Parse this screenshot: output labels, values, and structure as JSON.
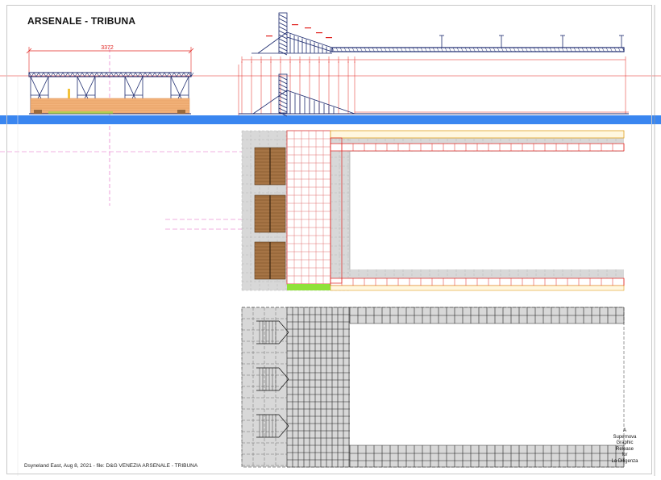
{
  "sheet": {
    "title": "ARSENALE - TRIBUNA",
    "footer": "Dsyneland East,  Aug 8, 2021 -  file:  D&G VENEZIA ARSENALE - TRIBUNA",
    "credit_lines": [
      "A",
      "Supernova",
      "Graphic",
      "Release",
      "for",
      "La Diligenza"
    ]
  },
  "drawings": {
    "front_elevation": {
      "dimension_label": "3372"
    },
    "side_elevation": {},
    "plan_upper": {},
    "plan_lower": {}
  },
  "colors": {
    "dimension_red": "#e0201c",
    "guide_magenta": "#e060c0",
    "band_blue": "#3a86f0",
    "structure_navy": "#1c2a6e",
    "seating_orange": "#f2b27a",
    "deck_wood": "#9a6a3c",
    "plan_grey": "#d8d8d8",
    "accent_green": "#8fe23a",
    "accent_pink": "#f08ad8"
  }
}
